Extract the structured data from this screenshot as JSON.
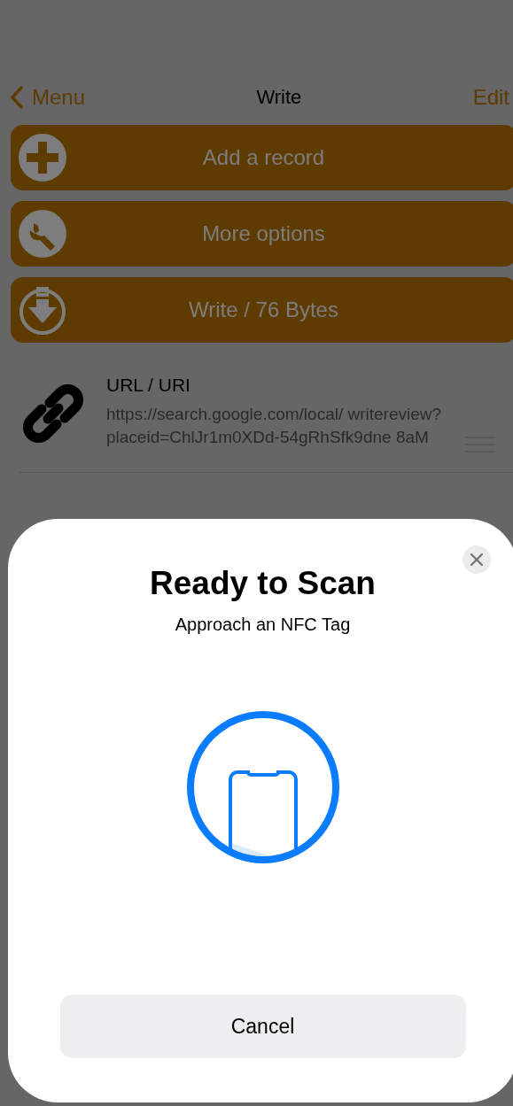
{
  "nav": {
    "back": "Menu",
    "title": "Write",
    "action": "Edit"
  },
  "actions": [
    {
      "kind": "add",
      "label": "Add a record"
    },
    {
      "kind": "options",
      "label": "More options"
    },
    {
      "kind": "write",
      "label": "Write / 76 Bytes"
    }
  ],
  "record": {
    "type": "URL / URI",
    "value": "https://search.google.com/local/ writereview? placeid=ChlJr1m0XDd-54gRhSfk9dne 8aM"
  },
  "sheet": {
    "title": "Ready to Scan",
    "subtitle": "Approach an NFC Tag",
    "cancel": "Cancel"
  }
}
